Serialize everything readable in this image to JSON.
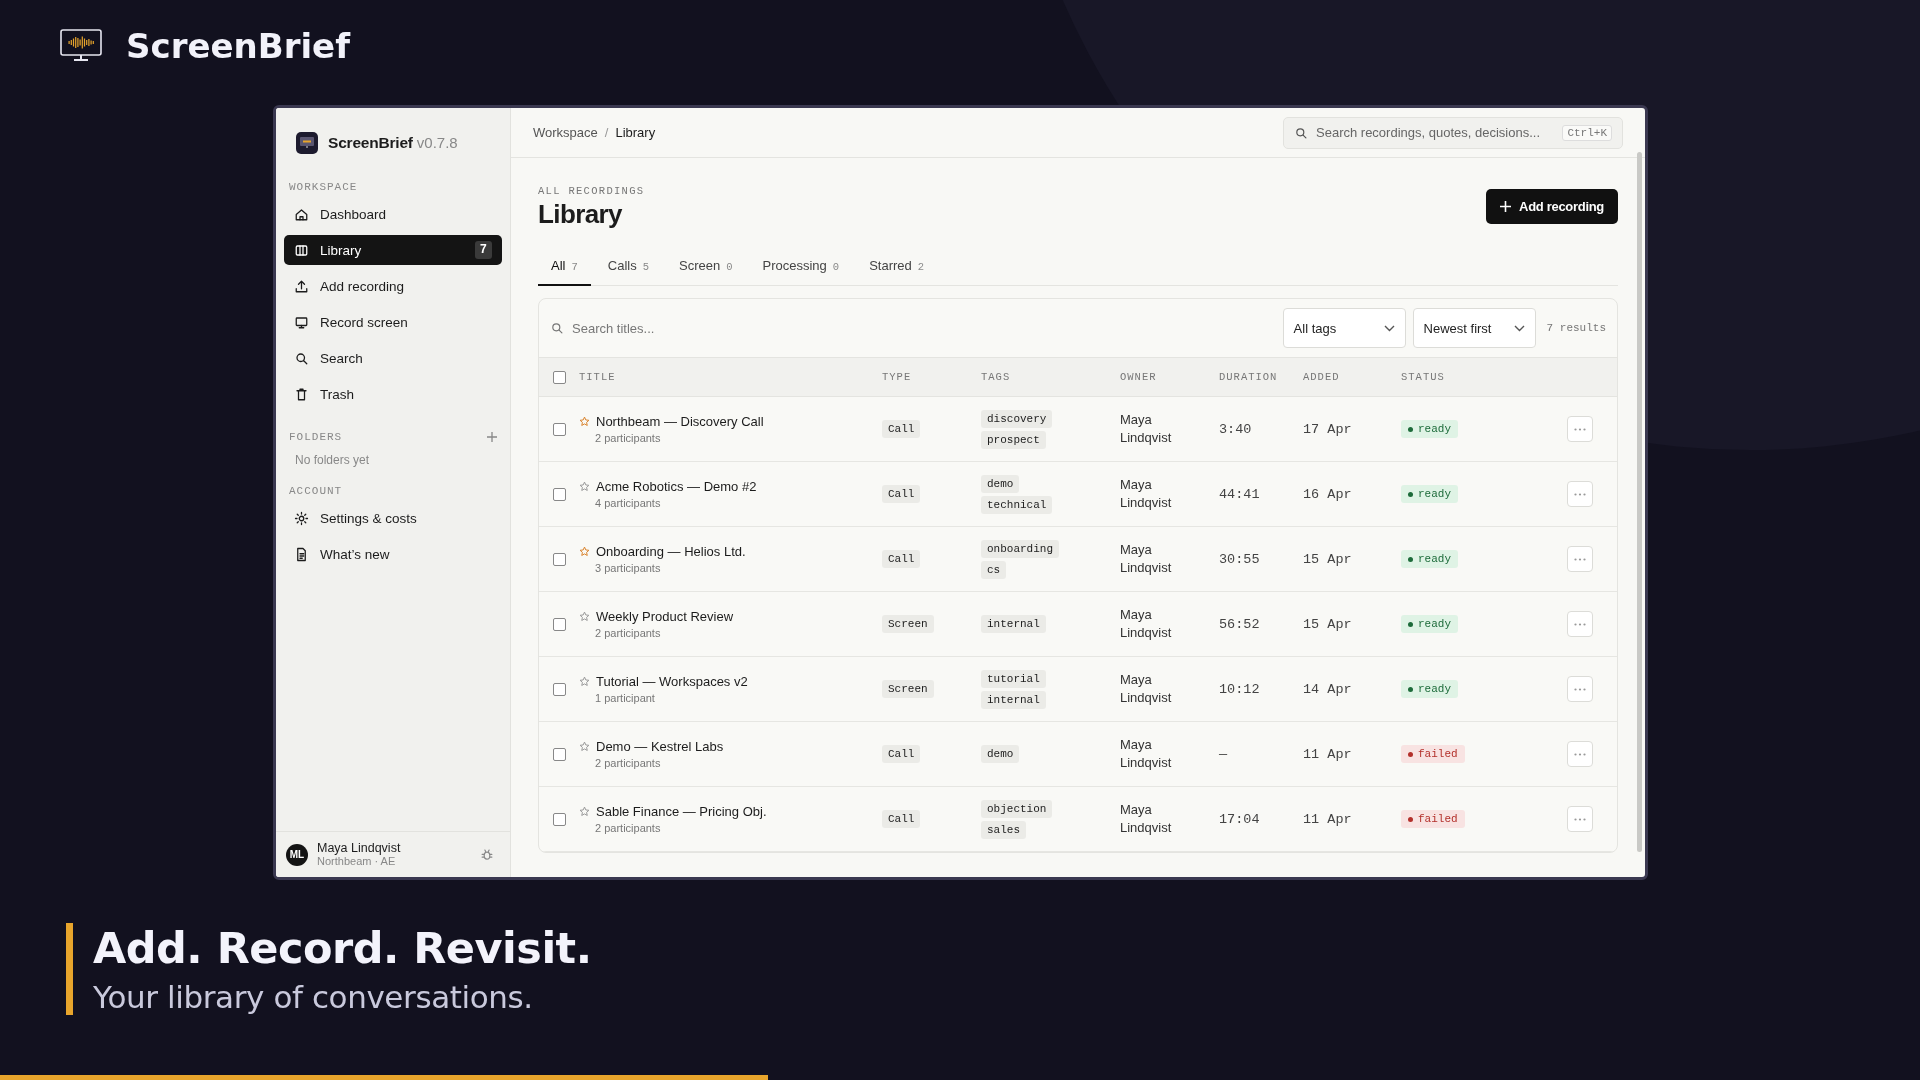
{
  "brand": {
    "name": "ScreenBrief"
  },
  "sidebar": {
    "app_name": "ScreenBrief",
    "version": "v0.7.8",
    "workspace": {
      "heading": "WORKSPACE",
      "items": [
        {
          "label": "Dashboard",
          "selected": false
        },
        {
          "label": "Library",
          "selected": true,
          "count": "7"
        },
        {
          "label": "Add recording",
          "selected": false
        },
        {
          "label": "Record screen",
          "selected": false
        },
        {
          "label": "Search",
          "selected": false
        },
        {
          "label": "Trash",
          "selected": false
        }
      ]
    },
    "folders": {
      "heading": "FOLDERS",
      "empty_text": "No folders yet"
    },
    "account": {
      "heading": "ACCOUNT",
      "items": [
        {
          "label": "Settings & costs",
          "selected": false
        },
        {
          "label": "What’s new",
          "selected": false
        }
      ]
    },
    "user": {
      "initials": "ML",
      "name": "Maya Lindqvist",
      "org": "Northbeam · AE"
    }
  },
  "topbar": {
    "breadcrumb": [
      "Workspace",
      "Library"
    ],
    "breadcrumb_separator": "/",
    "search": {
      "placeholder": "Search recordings, quotes, decisions...",
      "shortcut": "Ctrl+K"
    }
  },
  "page": {
    "eyebrow": "ALL RECORDINGS",
    "title": "Library",
    "add_button": "Add recording",
    "tabs": [
      {
        "label": "All",
        "count": "7",
        "selected": true
      },
      {
        "label": "Calls",
        "count": "5",
        "selected": false
      },
      {
        "label": "Screen",
        "count": "0",
        "selected": false
      },
      {
        "label": "Processing",
        "count": "0",
        "selected": false
      },
      {
        "label": "Starred",
        "count": "2",
        "selected": false
      }
    ]
  },
  "table": {
    "search": {
      "placeholder": "Search titles..."
    },
    "tag_filter": "All tags",
    "sort": "Newest first",
    "results": "7 results",
    "select_all_checked": false,
    "columns": [
      "TITLE",
      "TYPE",
      "TAGS",
      "OWNER",
      "DURATION",
      "ADDED",
      "STATUS"
    ],
    "rows": [
      {
        "checked": false,
        "starred": true,
        "title": "Northbeam — Discovery Call",
        "participants": "2 participants",
        "type": "Call",
        "tags": [
          "discovery",
          "prospect"
        ],
        "owner": "Maya Lindqvist",
        "duration": "3:40",
        "added": "17 Apr",
        "status": {
          "kind": "ready",
          "label": "ready"
        }
      },
      {
        "checked": false,
        "starred": false,
        "title": "Acme Robotics — Demo #2",
        "participants": "4 participants",
        "type": "Call",
        "tags": [
          "demo",
          "technical"
        ],
        "owner": "Maya Lindqvist",
        "duration": "44:41",
        "added": "16 Apr",
        "status": {
          "kind": "ready",
          "label": "ready"
        }
      },
      {
        "checked": false,
        "starred": true,
        "title": "Onboarding — Helios Ltd.",
        "participants": "3 participants",
        "type": "Call",
        "tags": [
          "onboarding",
          "cs"
        ],
        "owner": "Maya Lindqvist",
        "duration": "30:55",
        "added": "15 Apr",
        "status": {
          "kind": "ready",
          "label": "ready"
        }
      },
      {
        "checked": false,
        "starred": false,
        "title": "Weekly Product Review",
        "participants": "2 participants",
        "type": "Screen",
        "tags": [
          "internal"
        ],
        "owner": "Maya Lindqvist",
        "duration": "56:52",
        "added": "15 Apr",
        "status": {
          "kind": "ready",
          "label": "ready"
        }
      },
      {
        "checked": false,
        "starred": false,
        "title": "Tutorial — Workspaces v2",
        "participants": "1 participant",
        "type": "Screen",
        "tags": [
          "tutorial",
          "internal"
        ],
        "owner": "Maya Lindqvist",
        "duration": "10:12",
        "added": "14 Apr",
        "status": {
          "kind": "ready",
          "label": "ready"
        }
      },
      {
        "checked": false,
        "starred": false,
        "title": "Demo — Kestrel Labs",
        "participants": "2 participants",
        "type": "Call",
        "tags": [
          "demo"
        ],
        "owner": "Maya Lindqvist",
        "duration": "—",
        "added": "11 Apr",
        "status": {
          "kind": "failed",
          "label": "failed"
        }
      },
      {
        "checked": false,
        "starred": false,
        "title": "Sable Finance — Pricing Obj.",
        "participants": "2 participants",
        "type": "Call",
        "tags": [
          "objection",
          "sales"
        ],
        "owner": "Maya Lindqvist",
        "duration": "17:04",
        "added": "11 Apr",
        "status": {
          "kind": "failed",
          "label": "failed"
        }
      }
    ]
  },
  "tagline": {
    "headline": "Add. Record. Revisit.",
    "subtitle": "Your library of conversations."
  },
  "progress": {
    "level": 0.4
  }
}
